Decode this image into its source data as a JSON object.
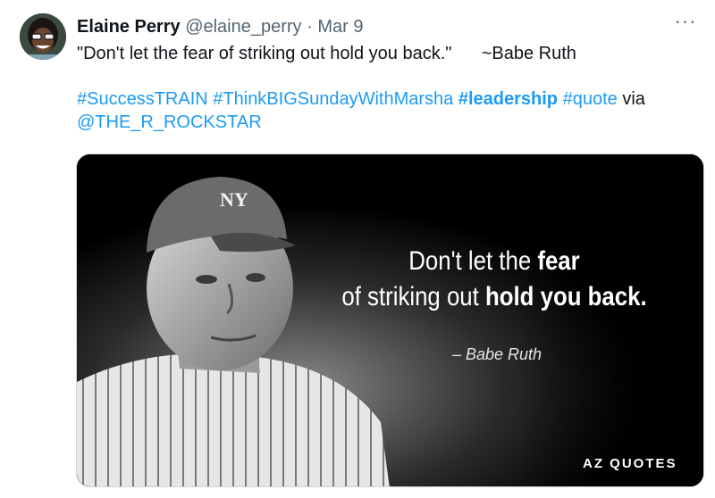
{
  "tweet": {
    "author_name": "Elaine Perry",
    "handle": "@elaine_perry",
    "separator": "·",
    "date": "Mar 9",
    "more_icon": "more-horizontal-icon",
    "text_line": "\"Don't let the fear of striking out hold you back.\"      ~Babe Ruth",
    "tags": [
      {
        "text": "#SuccessTRAIN"
      },
      {
        "text": "#ThinkBIGSundayWithMarsha"
      },
      {
        "text": "#leadership"
      },
      {
        "text": "#quote"
      }
    ],
    "via": "via",
    "mention": "@THE_R_ROCKSTAR"
  },
  "media": {
    "quote_part1": "Don't let the ",
    "quote_bold1": "fear",
    "quote_part2": "of striking out ",
    "quote_bold2": "hold you back.",
    "author": "– Babe Ruth",
    "brand": "AZ QUOTES"
  },
  "colors": {
    "link": "#1d9bf0",
    "secondary": "#536471",
    "text": "#0f1419"
  }
}
